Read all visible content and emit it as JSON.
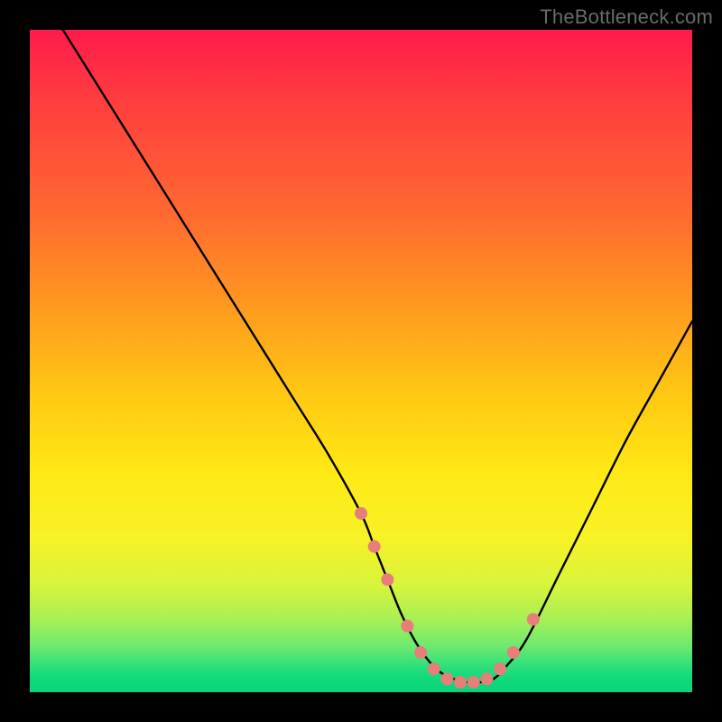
{
  "watermark": "TheBottleneck.com",
  "chart_data": {
    "type": "line",
    "title": "",
    "xlabel": "",
    "ylabel": "",
    "xlim": [
      0,
      100
    ],
    "ylim": [
      0,
      100
    ],
    "grid": false,
    "legend": false,
    "series": [
      {
        "name": "curve",
        "stroke": "#000000",
        "x": [
          5,
          10,
          15,
          20,
          25,
          30,
          35,
          40,
          45,
          50,
          52,
          54,
          56,
          58,
          60,
          62,
          64,
          66,
          68,
          70,
          72,
          75,
          80,
          85,
          90,
          95,
          100
        ],
        "y": [
          100,
          92,
          84,
          76,
          68,
          60,
          52,
          44,
          36,
          27,
          22,
          17,
          12,
          8,
          5,
          3,
          2,
          1.5,
          1.5,
          2,
          4,
          8,
          18,
          28,
          38,
          47,
          56
        ]
      }
    ],
    "markers": {
      "name": "dots",
      "color": "#e77e79",
      "radius_px": 7,
      "x": [
        50,
        52,
        54,
        57,
        59,
        61,
        63,
        65,
        67,
        69,
        71,
        73,
        76
      ],
      "y": [
        27,
        22,
        17,
        10,
        6,
        3.5,
        2,
        1.5,
        1.5,
        2,
        3.5,
        6,
        11
      ]
    }
  }
}
